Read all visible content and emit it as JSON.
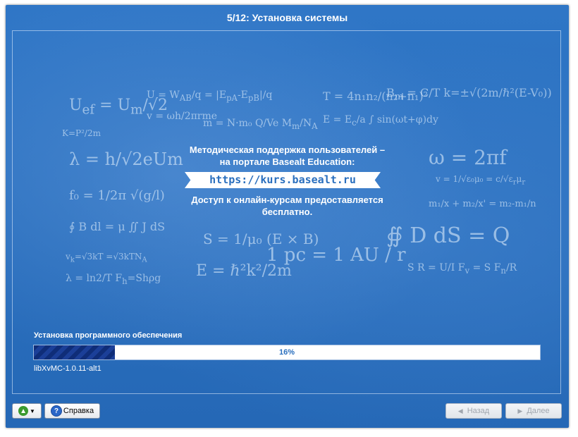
{
  "window": {
    "title": "5/12: Установка системы"
  },
  "banner": {
    "line1": "Методическая поддержка пользователей –",
    "line2": "на портале Basealt Education:",
    "url": "https://kurs.basealt.ru",
    "line3": "Доступ к онлайн-курсам предоставляется",
    "line4": "бесплатно."
  },
  "install": {
    "label": "Установка программного обеспечения",
    "progress_percent": 16,
    "progress_text": "16%",
    "package": "libXvMC-1.0.11-alt1"
  },
  "buttons": {
    "menu_icon": "up-arrow-icon",
    "help_label": "Справка",
    "back_label": "Назад",
    "next_label": "Далее"
  },
  "colors": {
    "background": "#2a6fbe",
    "progress_fill": "#0f2d78",
    "accent_text": "#2a6fbe"
  }
}
